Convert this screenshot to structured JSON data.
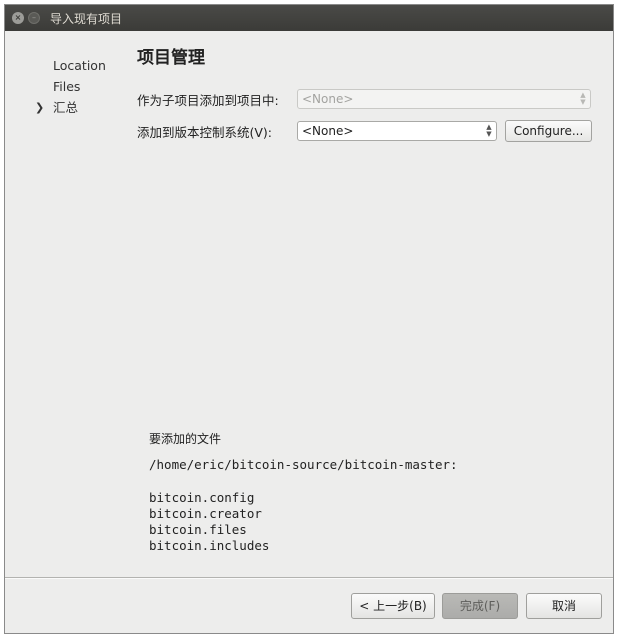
{
  "window": {
    "title": "导入现有项目",
    "close_glyph": "×",
    "min_glyph": "–"
  },
  "sidebar": {
    "items": [
      {
        "label": "Location",
        "active": false
      },
      {
        "label": "Files",
        "active": false
      },
      {
        "label": "汇总",
        "active": true
      }
    ],
    "active_marker": "❯"
  },
  "main": {
    "title": "项目管理",
    "subproject": {
      "label": "作为子项目添加到项目中:",
      "value": "<None>",
      "enabled": false
    },
    "vcs": {
      "label": "添加到版本控制系统(V):",
      "value": "<None>",
      "configure_label": "Configure..."
    },
    "spinner_up": "▲",
    "spinner_down": "▼",
    "files_heading": "要添加的文件",
    "files_path": "/home/eric/bitcoin-source/bitcoin-master:",
    "files": [
      "bitcoin.config",
      "bitcoin.creator",
      "bitcoin.files",
      "bitcoin.includes"
    ]
  },
  "footer": {
    "back_label": "< 上一步(B)",
    "finish_label": "完成(F)",
    "cancel_label": "取消"
  },
  "colors": {
    "titlebar": "#3b3b38",
    "window_bg": "#ededec",
    "finish_disabled": "#b3b3b0"
  },
  "icons": [
    "close-icon",
    "minimize-icon",
    "chevron-right-icon",
    "spinner-arrows-icon"
  ]
}
